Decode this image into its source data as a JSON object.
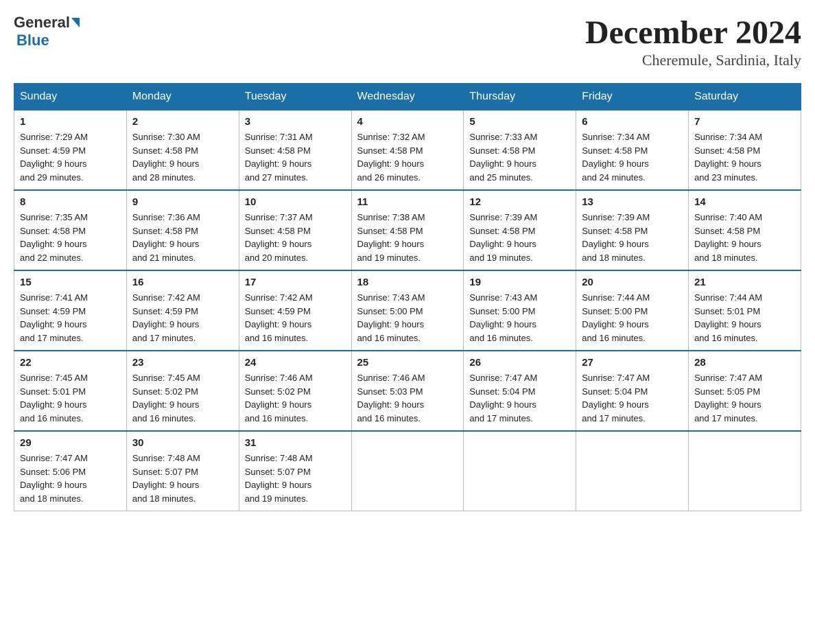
{
  "header": {
    "logo_general": "General",
    "logo_blue": "Blue",
    "title": "December 2024",
    "subtitle": "Cheremule, Sardinia, Italy"
  },
  "weekdays": [
    "Sunday",
    "Monday",
    "Tuesday",
    "Wednesday",
    "Thursday",
    "Friday",
    "Saturday"
  ],
  "weeks": [
    [
      {
        "day": "1",
        "sunrise": "7:29 AM",
        "sunset": "4:59 PM",
        "daylight": "9 hours and 29 minutes."
      },
      {
        "day": "2",
        "sunrise": "7:30 AM",
        "sunset": "4:58 PM",
        "daylight": "9 hours and 28 minutes."
      },
      {
        "day": "3",
        "sunrise": "7:31 AM",
        "sunset": "4:58 PM",
        "daylight": "9 hours and 27 minutes."
      },
      {
        "day": "4",
        "sunrise": "7:32 AM",
        "sunset": "4:58 PM",
        "daylight": "9 hours and 26 minutes."
      },
      {
        "day": "5",
        "sunrise": "7:33 AM",
        "sunset": "4:58 PM",
        "daylight": "9 hours and 25 minutes."
      },
      {
        "day": "6",
        "sunrise": "7:34 AM",
        "sunset": "4:58 PM",
        "daylight": "9 hours and 24 minutes."
      },
      {
        "day": "7",
        "sunrise": "7:34 AM",
        "sunset": "4:58 PM",
        "daylight": "9 hours and 23 minutes."
      }
    ],
    [
      {
        "day": "8",
        "sunrise": "7:35 AM",
        "sunset": "4:58 PM",
        "daylight": "9 hours and 22 minutes."
      },
      {
        "day": "9",
        "sunrise": "7:36 AM",
        "sunset": "4:58 PM",
        "daylight": "9 hours and 21 minutes."
      },
      {
        "day": "10",
        "sunrise": "7:37 AM",
        "sunset": "4:58 PM",
        "daylight": "9 hours and 20 minutes."
      },
      {
        "day": "11",
        "sunrise": "7:38 AM",
        "sunset": "4:58 PM",
        "daylight": "9 hours and 19 minutes."
      },
      {
        "day": "12",
        "sunrise": "7:39 AM",
        "sunset": "4:58 PM",
        "daylight": "9 hours and 19 minutes."
      },
      {
        "day": "13",
        "sunrise": "7:39 AM",
        "sunset": "4:58 PM",
        "daylight": "9 hours and 18 minutes."
      },
      {
        "day": "14",
        "sunrise": "7:40 AM",
        "sunset": "4:58 PM",
        "daylight": "9 hours and 18 minutes."
      }
    ],
    [
      {
        "day": "15",
        "sunrise": "7:41 AM",
        "sunset": "4:59 PM",
        "daylight": "9 hours and 17 minutes."
      },
      {
        "day": "16",
        "sunrise": "7:42 AM",
        "sunset": "4:59 PM",
        "daylight": "9 hours and 17 minutes."
      },
      {
        "day": "17",
        "sunrise": "7:42 AM",
        "sunset": "4:59 PM",
        "daylight": "9 hours and 16 minutes."
      },
      {
        "day": "18",
        "sunrise": "7:43 AM",
        "sunset": "5:00 PM",
        "daylight": "9 hours and 16 minutes."
      },
      {
        "day": "19",
        "sunrise": "7:43 AM",
        "sunset": "5:00 PM",
        "daylight": "9 hours and 16 minutes."
      },
      {
        "day": "20",
        "sunrise": "7:44 AM",
        "sunset": "5:00 PM",
        "daylight": "9 hours and 16 minutes."
      },
      {
        "day": "21",
        "sunrise": "7:44 AM",
        "sunset": "5:01 PM",
        "daylight": "9 hours and 16 minutes."
      }
    ],
    [
      {
        "day": "22",
        "sunrise": "7:45 AM",
        "sunset": "5:01 PM",
        "daylight": "9 hours and 16 minutes."
      },
      {
        "day": "23",
        "sunrise": "7:45 AM",
        "sunset": "5:02 PM",
        "daylight": "9 hours and 16 minutes."
      },
      {
        "day": "24",
        "sunrise": "7:46 AM",
        "sunset": "5:02 PM",
        "daylight": "9 hours and 16 minutes."
      },
      {
        "day": "25",
        "sunrise": "7:46 AM",
        "sunset": "5:03 PM",
        "daylight": "9 hours and 16 minutes."
      },
      {
        "day": "26",
        "sunrise": "7:47 AM",
        "sunset": "5:04 PM",
        "daylight": "9 hours and 17 minutes."
      },
      {
        "day": "27",
        "sunrise": "7:47 AM",
        "sunset": "5:04 PM",
        "daylight": "9 hours and 17 minutes."
      },
      {
        "day": "28",
        "sunrise": "7:47 AM",
        "sunset": "5:05 PM",
        "daylight": "9 hours and 17 minutes."
      }
    ],
    [
      {
        "day": "29",
        "sunrise": "7:47 AM",
        "sunset": "5:06 PM",
        "daylight": "9 hours and 18 minutes."
      },
      {
        "day": "30",
        "sunrise": "7:48 AM",
        "sunset": "5:07 PM",
        "daylight": "9 hours and 18 minutes."
      },
      {
        "day": "31",
        "sunrise": "7:48 AM",
        "sunset": "5:07 PM",
        "daylight": "9 hours and 19 minutes."
      },
      null,
      null,
      null,
      null
    ]
  ],
  "labels": {
    "sunrise": "Sunrise:",
    "sunset": "Sunset:",
    "daylight": "Daylight:"
  }
}
